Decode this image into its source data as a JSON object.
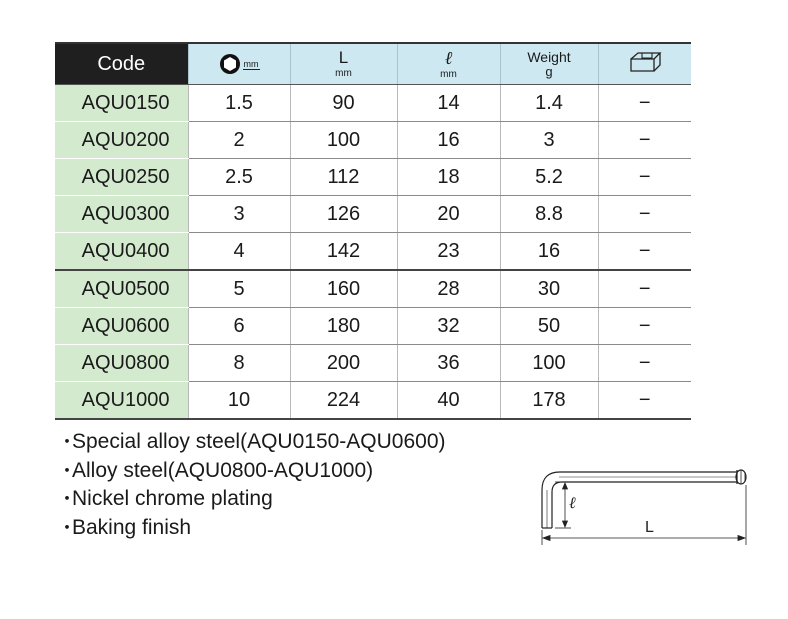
{
  "table": {
    "headers": {
      "code": "Code",
      "hex_icon": "hexagon-size-icon",
      "hex_unit": "mm",
      "length_label": "L",
      "length_unit": "mm",
      "short_label": "ℓ",
      "short_unit": "mm",
      "weight_label": "Weight",
      "weight_unit": "g",
      "case_icon": "case-icon"
    },
    "rows": [
      [
        "AQU0150",
        "1.5",
        "90",
        "14",
        "1.4",
        "−"
      ],
      [
        "AQU0200",
        "2",
        "100",
        "16",
        "3",
        "−"
      ],
      [
        "AQU0250",
        "2.5",
        "112",
        "18",
        "5.2",
        "−"
      ],
      [
        "AQU0300",
        "3",
        "126",
        "20",
        "8.8",
        "−"
      ],
      [
        "AQU0400",
        "4",
        "142",
        "23",
        "16",
        "−"
      ],
      [
        "AQU0500",
        "5",
        "160",
        "28",
        "30",
        "−"
      ],
      [
        "AQU0600",
        "6",
        "180",
        "32",
        "50",
        "−"
      ],
      [
        "AQU0800",
        "8",
        "200",
        "36",
        "100",
        "−"
      ],
      [
        "AQU1000",
        "10",
        "224",
        "40",
        "178",
        "−"
      ]
    ]
  },
  "notes": {
    "bullet": "・",
    "items": [
      "Special alloy steel(AQU0150-AQU0600)",
      "Alloy steel(AQU0800-AQU1000)",
      "Nickel chrome plating",
      "Baking finish"
    ]
  },
  "diagram": {
    "short_label": "ℓ",
    "length_label": "L",
    "icon": "l-wrench-icon"
  },
  "colors": {
    "code_header_bg": "#1f1f1f",
    "header_bg": "#cde8f1",
    "code_cell_bg": "#d4eacf"
  }
}
